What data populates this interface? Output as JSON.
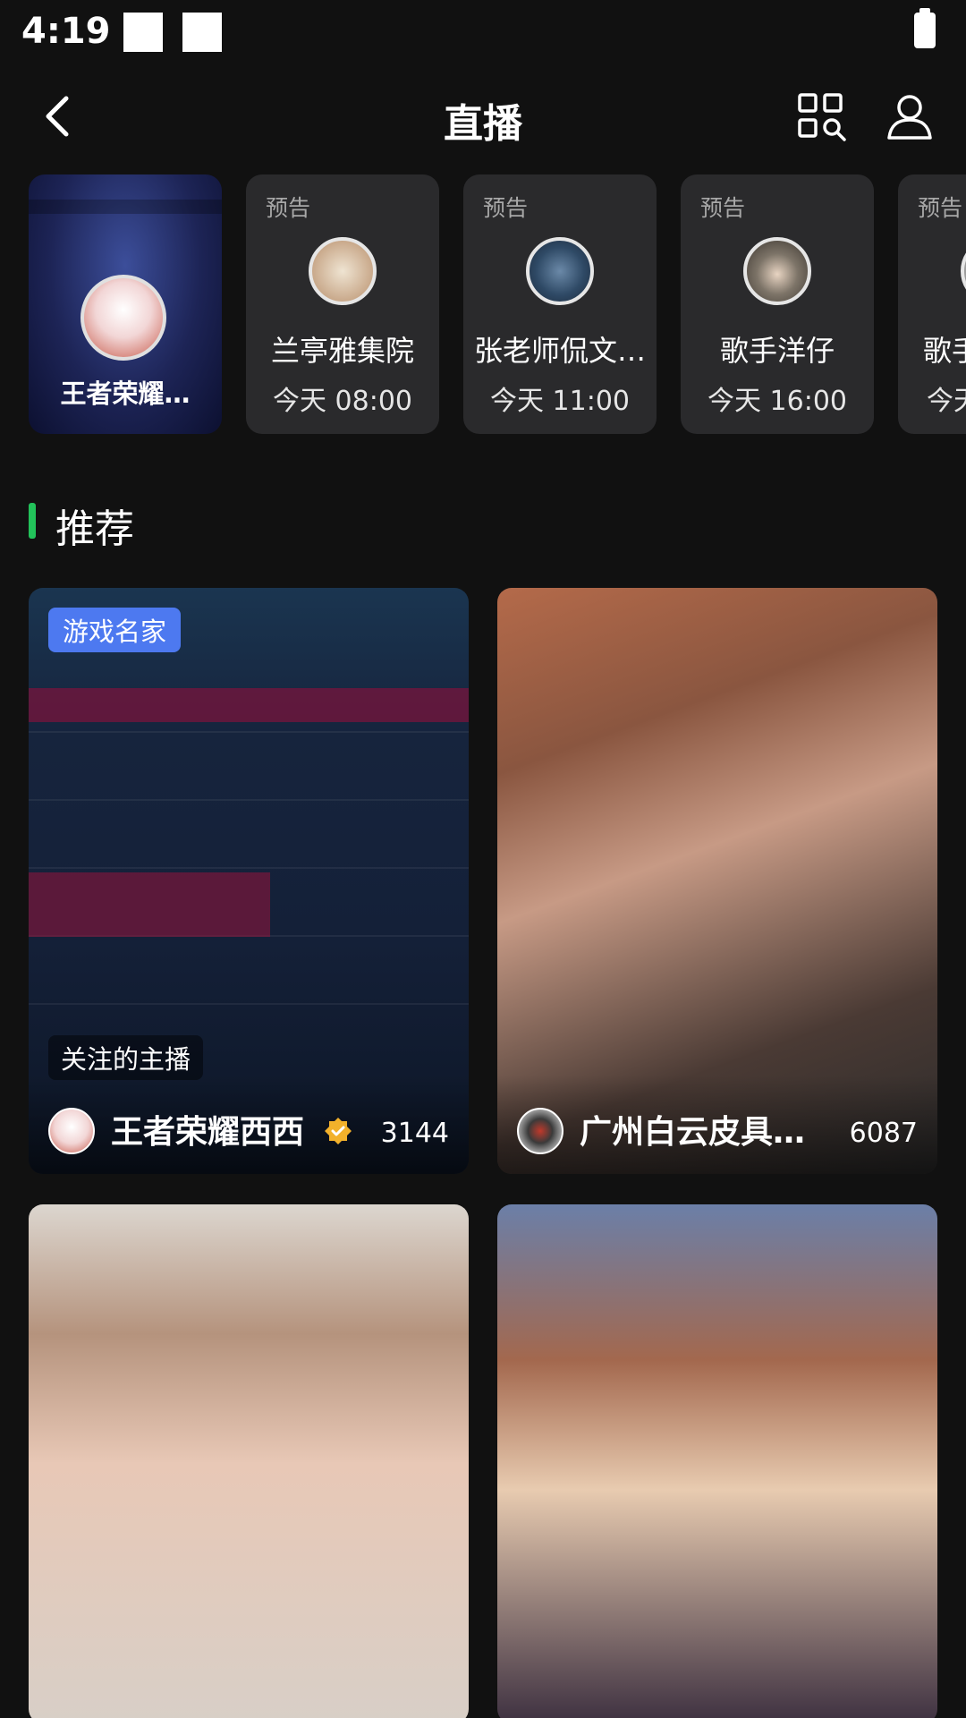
{
  "status": {
    "time": "4:19"
  },
  "header": {
    "title": "直播"
  },
  "carousel": {
    "live": {
      "name": "王者荣耀…",
      "avatar_color": "#f2d6d6"
    },
    "previews": [
      {
        "label": "预告",
        "name": "兰亭雅集院",
        "time": "今天 08:00",
        "avatar_color": "#c9a98b"
      },
      {
        "label": "预告",
        "name": "张老师侃文…",
        "time": "今天 11:00",
        "avatar_color": "#2f4a66"
      },
      {
        "label": "预告",
        "name": "歌手洋仔",
        "time": "今天 16:00",
        "avatar_color": "#7d7468"
      },
      {
        "label": "预告",
        "name": "歌手",
        "time": "今天",
        "avatar_color": "#9a9a9a"
      }
    ]
  },
  "section": {
    "title": "推荐"
  },
  "streams": [
    {
      "tag": "游戏名家",
      "follow_tag": "关注的主播",
      "name": "王者荣耀西西",
      "viewers": "3144",
      "verified": true,
      "avatar_color": "#f2d6d6"
    },
    {
      "name": "广州白云皮具…",
      "viewers": "6087",
      "avatar_color": "#3a3a3a"
    },
    {
      "name": "",
      "viewers": ""
    },
    {
      "name": "",
      "viewers": ""
    }
  ],
  "colors": {
    "background": "#111111",
    "accent_green": "#22c25a",
    "tag_blue": "#4d79f0",
    "verified_gold": "#f2b12b"
  }
}
